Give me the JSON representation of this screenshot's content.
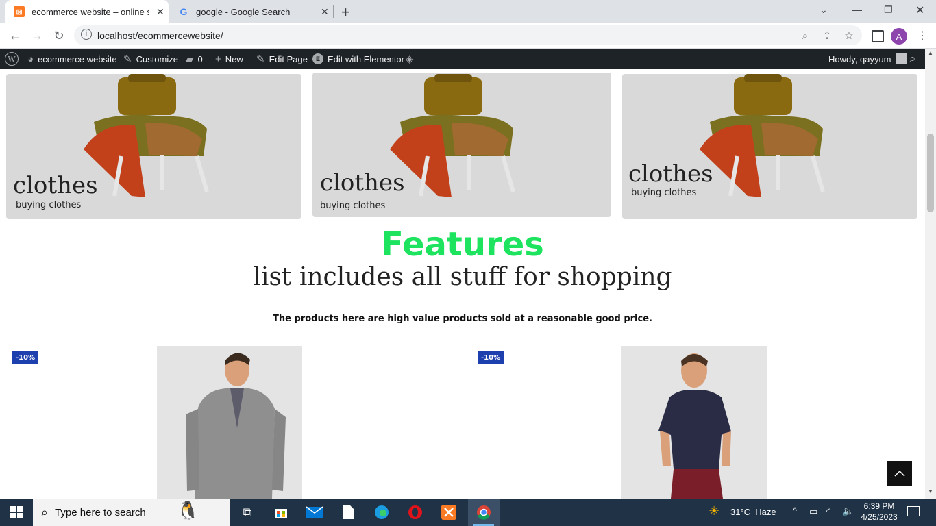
{
  "browser": {
    "tabs": [
      {
        "title": "ecommerce website – online stor",
        "active": true,
        "favicon": "xampp-icon"
      },
      {
        "title": "google - Google Search",
        "active": false,
        "favicon": "google-icon"
      }
    ],
    "url": "localhost/ecommercewebsite/",
    "profile_initial": "A"
  },
  "adminbar": {
    "site_name": "ecommerce website",
    "customize": "Customize",
    "comments_count": "0",
    "new": "New",
    "edit_page": "Edit Page",
    "edit_elementor": "Edit with Elementor",
    "howdy": "Howdy, qayyum"
  },
  "cards": [
    {
      "title": "clothes",
      "subtitle": "buying clothes"
    },
    {
      "title": "clothes",
      "subtitle": "buying clothes"
    },
    {
      "title": "clothes",
      "subtitle": "buying clothes"
    }
  ],
  "features": {
    "title": "Features",
    "subtitle": "list includes all stuff for shopping",
    "description": "The products here are high value products  sold at a reasonable good price."
  },
  "products": [
    {
      "badge": "-10%"
    },
    {
      "badge": "-10%"
    }
  ],
  "colors": {
    "features_title": "#1ee35f",
    "badge": "#1e3fae",
    "card_bg": "#d9d9d9"
  },
  "taskbar": {
    "search_placeholder": "Type here to search",
    "weather": "31°C  Haze",
    "time": "6:39 PM",
    "date": "4/25/2023"
  }
}
